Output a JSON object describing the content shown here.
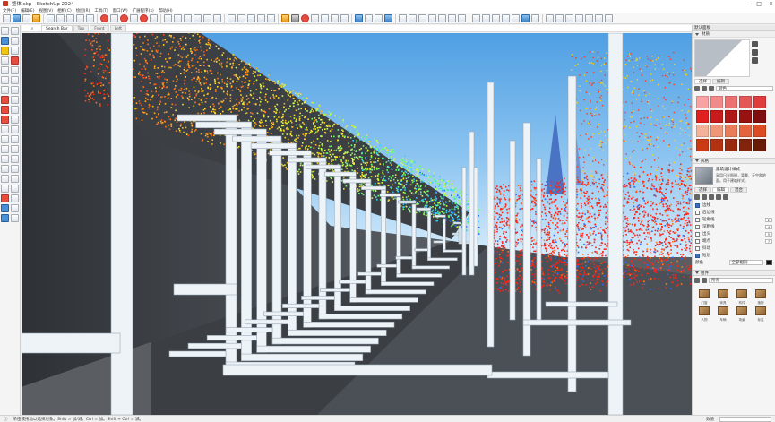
{
  "window": {
    "title": "整体.skp - SketchUp 2024"
  },
  "menu": [
    "文件(F)",
    "编辑(E)",
    "视图(V)",
    "相机(C)",
    "绘图(R)",
    "工具(T)",
    "窗口(W)",
    "扩展程序(x)",
    "帮助(H)"
  ],
  "tabs": [
    {
      "label": "Search Bar",
      "active": true
    },
    {
      "label": "Top",
      "active": false
    },
    {
      "label": "Front",
      "active": false
    },
    {
      "label": "Left",
      "active": false
    }
  ],
  "status": {
    "hint": "单击或拖动以选择对象。Shift = 加/减。Ctrl = 加。Shift + Ctrl = 减。",
    "measure_label": "数值"
  },
  "tray": {
    "title": "默认面板",
    "materials_section": "材质",
    "materials_tabs": [
      "选择",
      "编辑"
    ],
    "material_name": "颜色",
    "swatch_colors": [
      "#f7a3a3",
      "#f28a8a",
      "#ec7272",
      "#e45757",
      "#df3d3d",
      "#e02020",
      "#c81c1c",
      "#b01717",
      "#981212",
      "#800e0e",
      "#f4b29a",
      "#ef9678",
      "#e97d5a",
      "#e3643e",
      "#dc4b22",
      "#cc3a14",
      "#b33211",
      "#9a2a0e",
      "#82230b",
      "#6a1b08"
    ],
    "styles_section": "风格",
    "style_name": "建筑设计样式",
    "style_desc": "采用日光照明，背景、天空和地面。用于建筑样式。",
    "styles_tabs": [
      "选择",
      "编辑",
      "混合"
    ],
    "edge_settings": [
      {
        "label": "边线",
        "checked": true
      },
      {
        "label": "后边线",
        "checked": false
      },
      {
        "label": "轮廓线",
        "checked": false,
        "value": "2"
      },
      {
        "label": "深粗线",
        "checked": false,
        "value": "4"
      },
      {
        "label": "出头",
        "checked": false,
        "value": "5"
      },
      {
        "label": "端点",
        "checked": false,
        "value": "7"
      },
      {
        "label": "抖动",
        "checked": false
      },
      {
        "label": "短划",
        "checked": true
      }
    ],
    "color_label": "颜色",
    "color_mode": "全部相同",
    "components_section": "组件",
    "components_filter": "所有",
    "component_labels": [
      "门窗",
      "家具",
      "构件",
      "植物",
      "人物",
      "车辆",
      "场景",
      "标注"
    ]
  },
  "colors": {
    "sky_top": "#5fa9e6",
    "sky_bottom": "#cbe6fb",
    "wall_dark": "#3d4146",
    "frame_white": "#f0f4f8"
  }
}
